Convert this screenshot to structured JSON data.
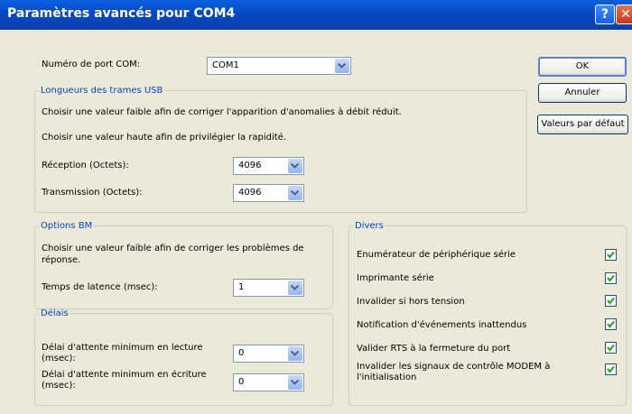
{
  "window": {
    "title": "Paramètres avancés pour COM4",
    "help_label": "?",
    "close_label": "✕"
  },
  "port": {
    "label": "Numéro de port COM:",
    "value": "COM1"
  },
  "buttons": {
    "ok": "OK",
    "cancel": "Annuler",
    "defaults": "Valeurs par défaut"
  },
  "usb": {
    "legend": "Longueurs des trames USB",
    "hint_low": "Choisir une valeur faible afin de corriger  l'apparition d'anomalies à débit réduit.",
    "hint_high": "Choisir une valeur haute afin de privilégier la rapidité.",
    "rx_label": "Réception (Octets):",
    "rx_value": "4096",
    "tx_label": "Transmission (Octets):",
    "tx_value": "4096"
  },
  "bm": {
    "legend": "Options BM",
    "hint_line1": "Choisir une valeur faible afin de corriger les problèmes de",
    "hint_line2": "réponse.",
    "latency_label": "Temps de latence (msec):",
    "latency_value": "1"
  },
  "delays": {
    "legend": "Délais",
    "read_line1": "Délai d'attente minimum en lecture",
    "read_line2": "(msec):",
    "read_value": "0",
    "write_line1": "Délai d'attente minimum en écriture",
    "write_line2": "(msec):",
    "write_value": "0"
  },
  "misc": {
    "legend": "Divers",
    "items": [
      {
        "label": "Enumérateur de périphérique série",
        "checked": true
      },
      {
        "label": "Imprimante série",
        "checked": true
      },
      {
        "label": "Invalider si hors tension",
        "checked": true
      },
      {
        "label": "Notification d'événements inattendus",
        "checked": true
      },
      {
        "label": "Valider RTS à la fermeture du port",
        "checked": true
      },
      {
        "label_line1": "Invalider les signaux de contrôle MODEM à",
        "label_line2": "l'initialisation",
        "checked": true
      }
    ]
  },
  "icons": {
    "dropdown": "chevron-down-icon",
    "check": "checkmark-icon"
  },
  "colors": {
    "titlebar": "#0a5fe0",
    "group_legend": "#0046d5",
    "close_button": "#c2361d",
    "check": "#21a121"
  }
}
